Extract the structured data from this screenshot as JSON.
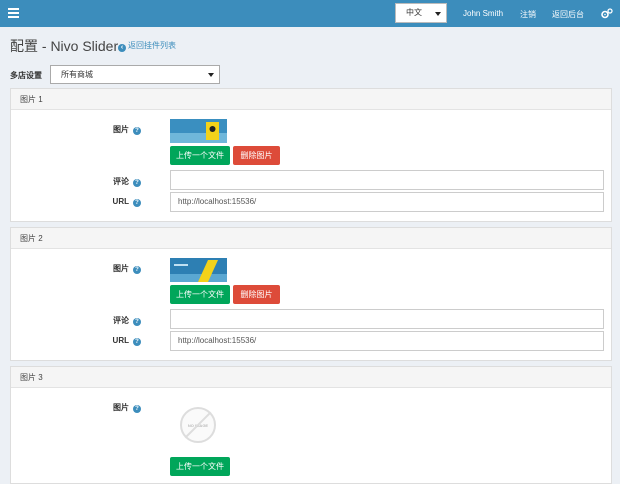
{
  "topbar": {
    "language": "中文",
    "user": "John Smith",
    "logout": "注销",
    "back_admin": "返回后台"
  },
  "header": {
    "title": "配置 - Nivo Slider",
    "back_link": "返回挂件列表"
  },
  "store": {
    "label": "多店设置",
    "selected": "所有商城"
  },
  "labels": {
    "picture": "图片",
    "comment": "评论",
    "url": "URL",
    "upload": "上传一个文件",
    "delete": "删除图片",
    "no_image": "NO IMAGE"
  },
  "panels": [
    {
      "title": "图片 1",
      "url": "http://localhost:15536/",
      "comment": ""
    },
    {
      "title": "图片 2",
      "url": "http://localhost:15536/",
      "comment": ""
    },
    {
      "title": "图片 3"
    }
  ],
  "colors": {
    "topbar": "#3c8dbc",
    "success": "#00a65a",
    "danger": "#dd4b39",
    "background": "#ecf0f5"
  }
}
